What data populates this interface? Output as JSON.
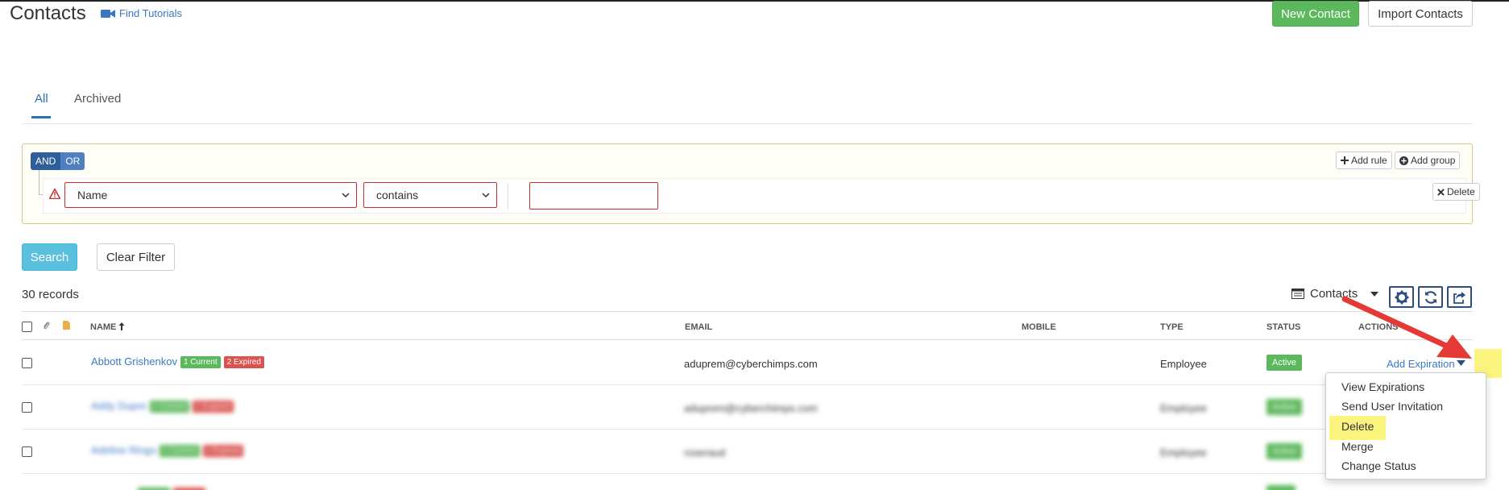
{
  "header": {
    "title": "Contacts",
    "tutorials_label": "Find Tutorials",
    "new_contact_label": "New Contact",
    "import_contacts_label": "Import Contacts"
  },
  "tabs": [
    {
      "label": "All",
      "active": true
    },
    {
      "label": "Archived",
      "active": false
    }
  ],
  "filter": {
    "and_label": "AND",
    "or_label": "OR",
    "add_rule_label": "Add rule",
    "add_group_label": "Add group",
    "delete_label": "Delete",
    "field_value": "Name",
    "operator_value": "contains",
    "text_value": ""
  },
  "actions": {
    "search_label": "Search",
    "clear_filter_label": "Clear Filter"
  },
  "list": {
    "records_label": "30 records",
    "view_label": "Contacts",
    "columns": {
      "name": "NAME",
      "email": "EMAIL",
      "mobile": "MOBILE",
      "type": "TYPE",
      "status": "STATUS",
      "actions": "ACTIONS"
    },
    "rows": [
      {
        "name": "Abbott Grishenkov",
        "current": "1 Current",
        "expired": "2 Expired",
        "email": "aduprem@cyberchimps.com",
        "type": "Employee",
        "status": "Active",
        "action": "Add Expiration"
      },
      {
        "name": "Addy Dupre",
        "current": "1 Current",
        "expired": "1 Expired",
        "email": "aduprem@cyberchimps.com",
        "type": "Employee",
        "status": "Active",
        "action": ""
      },
      {
        "name": "Adeline Ringo",
        "current": "1 Current",
        "expired": "1 Expired",
        "email": "roseraud",
        "type": "Employee",
        "status": "Active",
        "action": ""
      }
    ]
  },
  "dropdown": {
    "items": [
      "View Expirations",
      "Send User Invitation",
      "Delete",
      "Merge",
      "Change Status"
    ]
  },
  "colors": {
    "primary_green": "#5cb85c",
    "danger_red": "#d9534f",
    "info_blue": "#5bc0de",
    "link_blue": "#3a78c3",
    "highlight_yellow": "#fbf47e",
    "arrow_red": "#e53935"
  }
}
